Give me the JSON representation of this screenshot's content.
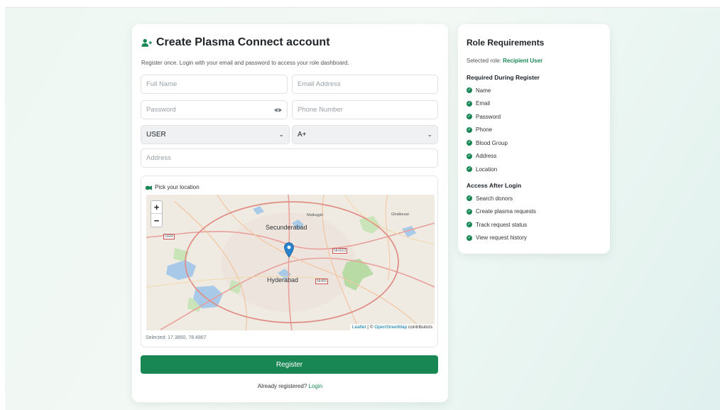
{
  "form": {
    "title": "Create Plasma Connect account",
    "subtitle": "Register once. Login with your email and password to access your role dashboard.",
    "fields": {
      "full_name_placeholder": "Full Name",
      "email_placeholder": "Email Address",
      "password_placeholder": "Password",
      "phone_placeholder": "Phone Number",
      "role_value": "USER",
      "blood_group_value": "A+",
      "address_placeholder": "Address"
    },
    "map": {
      "label": "Pick your location",
      "zoom_in": "+",
      "zoom_out": "−",
      "attribution_leaflet": "Leaflet",
      "attribution_sep": " | © ",
      "attribution_osm": "OpenStreetMap",
      "attribution_tail": " contributors",
      "places": {
        "secunderabad": "Secunderabad",
        "hyderabad": "Hyderabad",
        "malkajgiri": "Malkajgiri",
        "ghatkesar": "Ghatkesar",
        "nh163": "NH163",
        "orr": "ORR",
        "nh65": "NH65"
      },
      "selected": "Selected: 17.3850, 78.4867"
    },
    "register_label": "Register",
    "login_prompt": "Already registered?",
    "login_link": "Login"
  },
  "requirements": {
    "title": "Role Requirements",
    "selected_prefix": "Selected role:",
    "selected_role": "Recipient User",
    "register_heading": "Required During Register",
    "register_items": [
      "Name",
      "Email",
      "Password",
      "Phone",
      "Blood Group",
      "Address",
      "Location"
    ],
    "access_heading": "Access After Login",
    "access_items": [
      "Search donors",
      "Create plasma requests",
      "Track request status",
      "View request history"
    ]
  },
  "colors": {
    "accent": "#198754",
    "marker": "#2a81cb"
  }
}
